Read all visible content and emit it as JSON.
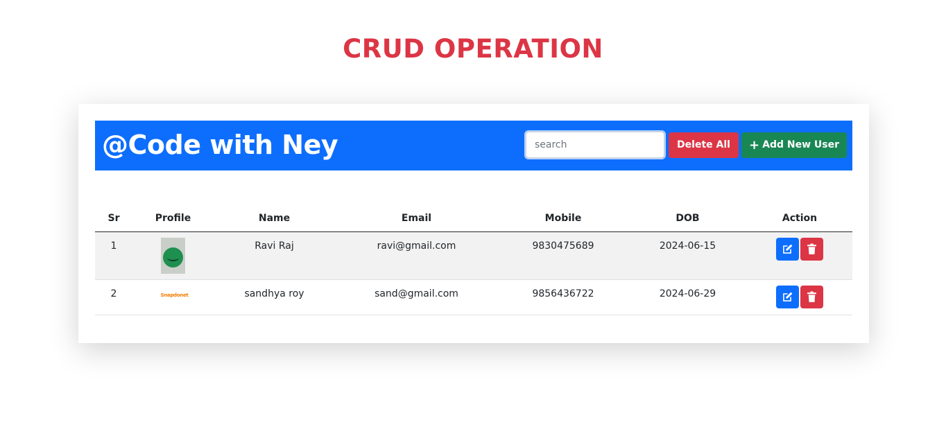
{
  "page": {
    "title": "CRUD OPERATION"
  },
  "header": {
    "brand": "@Code with Ney",
    "search_placeholder": "search",
    "search_value": "",
    "delete_all_label": "Delete All",
    "add_user_label": "Add New User",
    "accent_color": "#0d6efd"
  },
  "table": {
    "columns": [
      "Sr",
      "Profile",
      "Name",
      "Email",
      "Mobile",
      "DOB",
      "Action"
    ],
    "rows": [
      {
        "sr": "1",
        "profile_image": "green-smiley-ball-photo",
        "name": "Ravi Raj",
        "email": "ravi@gmail.com",
        "mobile": "9830475689",
        "dob": "2024-06-15"
      },
      {
        "sr": "2",
        "profile_image": "small-logo-image",
        "profile_logo_text": "Snapdonet",
        "name": "sandhya roy",
        "email": "sand@gmail.com",
        "mobile": "9856436722",
        "dob": "2024-06-29"
      }
    ]
  },
  "icons": {
    "add": "plus-icon",
    "edit": "edit-icon",
    "delete": "trash-icon"
  },
  "colors": {
    "title": "#dc3545",
    "danger": "#dc3545",
    "success": "#198754",
    "primary": "#0d6efd"
  }
}
